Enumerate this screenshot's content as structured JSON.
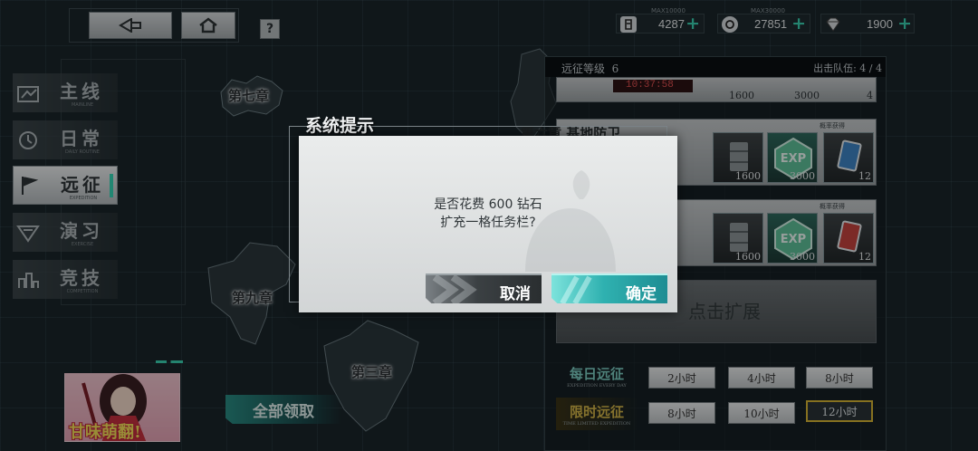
{
  "nav": {
    "help_label": "?"
  },
  "resources": [
    {
      "icon": "fuel-icon",
      "max": "MAX10000",
      "value": "4287",
      "plus": "+"
    },
    {
      "icon": "ammo-icon",
      "max": "MAX30000",
      "value": "27851",
      "plus": "+"
    },
    {
      "icon": "diamond-icon",
      "max": "",
      "value": "1900",
      "plus": "+"
    }
  ],
  "map": {
    "chapter_7": "第七章",
    "chapter_9": "第九章",
    "chapter_3": "第三章"
  },
  "sidebar": {
    "items": [
      {
        "label": "主线",
        "sub": "MAINLINE",
        "icon": "mainline-icon"
      },
      {
        "label": "日常",
        "sub": "DAILY ROUTINE",
        "icon": "daily-icon"
      },
      {
        "label": "远征",
        "sub": "EXPEDITION",
        "icon": "flag-icon"
      },
      {
        "label": "演习",
        "sub": "EXERCISE",
        "icon": "exercise-icon"
      },
      {
        "label": "竞技",
        "sub": "COMPETITION",
        "icon": "competition-icon"
      }
    ],
    "active_index": 2
  },
  "character_card": {
    "title": "甘味萌翻!"
  },
  "claim_all_label": "全部领取",
  "expedition": {
    "level_label": "远征等级",
    "level_value": "6",
    "queue_label": "出击队伍: 4 / 4",
    "timer": "10:37:58",
    "card_top_values": [
      "1600",
      "3000",
      "4"
    ],
    "card_1": {
      "title": "第六章 基地防卫",
      "prob_label": "概率获得",
      "rewards": [
        "1600",
        "3000",
        "12"
      ]
    },
    "card_2": {
      "prob_label": "概率获得",
      "rewards": [
        "1600",
        "3000",
        "12"
      ]
    },
    "expand_label": "点击扩展",
    "daily_label": "每日远征",
    "daily_sub": "EXPEDITION EVERY DAY",
    "daily_times": [
      "2小时",
      "4小时",
      "8小时"
    ],
    "limited_label": "限时远征",
    "limited_sub": "TIME LIMITED EXPEDITION",
    "limited_times": [
      "8小时",
      "10小时",
      "12小时"
    ],
    "selected_time": "12小时"
  },
  "dialog": {
    "title": "系统提示",
    "message_line1": "是否花费 600 钻石",
    "message_line2": "扩充一格任务栏?",
    "cancel_label": "取消",
    "confirm_label": "确定"
  },
  "colors": {
    "accent": "#36d8b8",
    "confirm": "#2fb1b0",
    "timer_red": "#e35252",
    "selected_border": "#d9b635"
  }
}
